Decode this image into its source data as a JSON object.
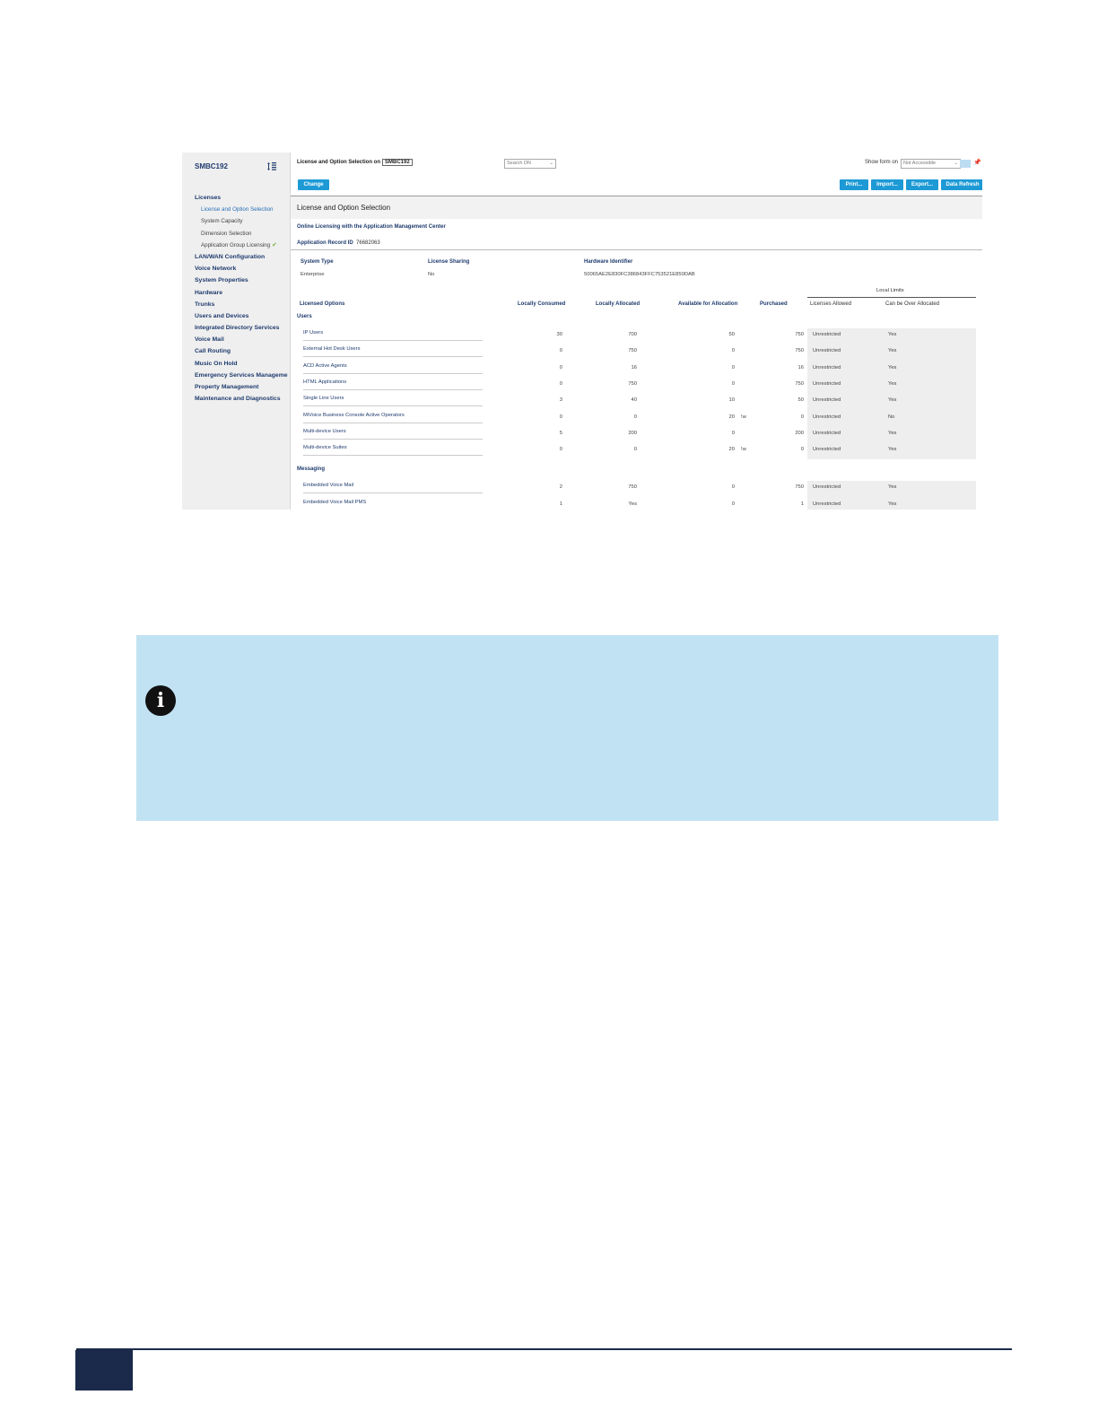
{
  "sidebar": {
    "title": "SMBC192",
    "items": [
      {
        "label": "Licenses",
        "level": 0
      },
      {
        "label": "License and Option Selection",
        "level": 1,
        "active": true
      },
      {
        "label": "System Capacity",
        "level": 1
      },
      {
        "label": "Dimension Selection",
        "level": 1
      },
      {
        "label": "Application Group Licensing",
        "level": 1,
        "check": true
      },
      {
        "label": "LAN/WAN Configuration",
        "level": 0
      },
      {
        "label": "Voice Network",
        "level": 0
      },
      {
        "label": "System Properties",
        "level": 0
      },
      {
        "label": "Hardware",
        "level": 0
      },
      {
        "label": "Trunks",
        "level": 0
      },
      {
        "label": "Users and Devices",
        "level": 0
      },
      {
        "label": "Integrated Directory Services",
        "level": 0
      },
      {
        "label": "Voice Mail",
        "level": 0
      },
      {
        "label": "Call Routing",
        "level": 0
      },
      {
        "label": "Music On Hold",
        "level": 0
      },
      {
        "label": "Emergency Services Manageme",
        "level": 0
      },
      {
        "label": "Property Management",
        "level": 0
      },
      {
        "label": "Maintenance and Diagnostics",
        "level": 0
      }
    ]
  },
  "topbar": {
    "crumb_label": "License and Option Selection on",
    "crumb_target": "SMBC192",
    "search_placeholder": "Search DN",
    "show_form_label": "Show form on",
    "show_form_value": "Not Accessible"
  },
  "buttons": {
    "change": "Change",
    "print": "Print...",
    "import": "Import...",
    "export": "Export...",
    "refresh": "Data Refresh"
  },
  "form": {
    "title": "License and Option Selection",
    "online_licensing": "Online Licensing with the Application Management Center",
    "app_record_label": "Application Record ID",
    "app_record_value": "76682063",
    "system_type_label": "System Type",
    "system_type_value": "Enterprise",
    "license_sharing_label": "License Sharing",
    "license_sharing_value": "No",
    "hardware_id_label": "Hardware Identifier",
    "hardware_id_value": "50065AE2E830FC386843FFC753521E850DAB"
  },
  "table": {
    "local_limits": "Local Limits",
    "columns": [
      "Licensed Options",
      "Locally Consumed",
      "Locally Allocated",
      "Available for Allocation",
      "Purchased",
      "Licenses Allowed",
      "Can be Over Allocated"
    ],
    "sections": [
      {
        "name": "Users",
        "rows": [
          {
            "option": "IP Users",
            "consumed": "30",
            "allocated": "700",
            "available": "50",
            "purchased": "750",
            "allowed": "Unrestricted",
            "over": "Yes"
          },
          {
            "option": "External Hot Desk Users",
            "consumed": "0",
            "allocated": "750",
            "available": "0",
            "purchased": "750",
            "allowed": "Unrestricted",
            "over": "Yes"
          },
          {
            "option": "ACD Active Agents",
            "consumed": "0",
            "allocated": "16",
            "available": "0",
            "purchased": "16",
            "allowed": "Unrestricted",
            "over": "Yes"
          },
          {
            "option": "HTML Applications",
            "consumed": "0",
            "allocated": "750",
            "available": "0",
            "purchased": "750",
            "allowed": "Unrestricted",
            "over": "Yes"
          },
          {
            "option": "Single Line Users",
            "consumed": "3",
            "allocated": "40",
            "available": "10",
            "purchased": "50",
            "allowed": "Unrestricted",
            "over": "Yes"
          },
          {
            "option": "MiVoice Business Console Active Operators",
            "consumed": "0",
            "allocated": "0",
            "available": "20",
            "flag": "!w",
            "purchased": "0",
            "allowed": "Unrestricted",
            "over": "No"
          },
          {
            "option": "Multi-device Users",
            "consumed": "5",
            "allocated": "200",
            "available": "0",
            "purchased": "200",
            "allowed": "Unrestricted",
            "over": "Yes"
          },
          {
            "option": "Multi-device Suites",
            "consumed": "0",
            "allocated": "0",
            "available": "20",
            "flag": "!w",
            "purchased": "0",
            "allowed": "Unrestricted",
            "over": "Yes"
          }
        ]
      },
      {
        "name": "Messaging",
        "rows": [
          {
            "option": "Embedded Voice Mail",
            "consumed": "2",
            "allocated": "750",
            "available": "0",
            "purchased": "750",
            "allowed": "Unrestricted",
            "over": "Yes"
          },
          {
            "option": "Embedded Voice Mail PMS",
            "consumed": "1",
            "allocated": "Yes",
            "available": "0",
            "purchased": "1",
            "allowed": "Unrestricted",
            "over": "Yes"
          }
        ]
      }
    ]
  },
  "note": {
    "icon": "info-icon",
    "glyph": "i"
  },
  "colors": {
    "accent": "#1d9ad6",
    "navy": "#1b2a4a",
    "callout": "#c1e2f3"
  }
}
